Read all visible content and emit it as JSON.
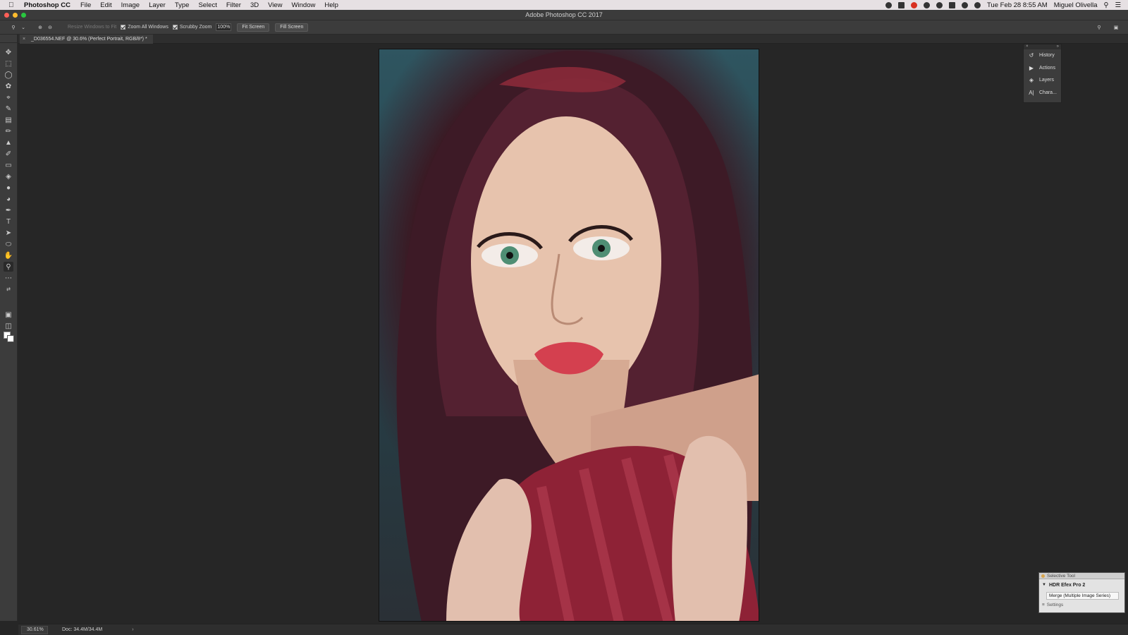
{
  "menubar": {
    "app_name": "Photoshop CC",
    "items": [
      "File",
      "Edit",
      "Image",
      "Layer",
      "Type",
      "Select",
      "Filter",
      "3D",
      "View",
      "Window",
      "Help"
    ],
    "datetime": "Tue Feb 28  8:55 AM",
    "user": "Miguel Olivella"
  },
  "window": {
    "title": "Adobe Photoshop CC 2017"
  },
  "options": {
    "resize_windows": "Resize Windows to Fit",
    "zoom_all_windows": "Zoom All Windows",
    "scrubby_zoom": "Scrubby Zoom",
    "zoom_value": "100%",
    "fit_screen": "Fit Screen",
    "fill_screen": "Fill Screen"
  },
  "document": {
    "tab_title": "_D036554.NEF @ 30.6% (Perfect Portrait, RGB/8*) *"
  },
  "panels": {
    "items": [
      {
        "label": "History",
        "icon": "history-icon"
      },
      {
        "label": "Actions",
        "icon": "actions-icon"
      },
      {
        "label": "Layers",
        "icon": "layers-icon"
      },
      {
        "label": "Chara...",
        "icon": "character-icon"
      }
    ]
  },
  "selective_tool": {
    "title": "Selective Tool",
    "plugin": "HDR Efex Pro 2",
    "merge": "Merge (Multiple Image Series)",
    "settings": "Settings"
  },
  "status": {
    "zoom": "30.61%",
    "doc_info": "Doc: 34.4M/34.4M"
  }
}
